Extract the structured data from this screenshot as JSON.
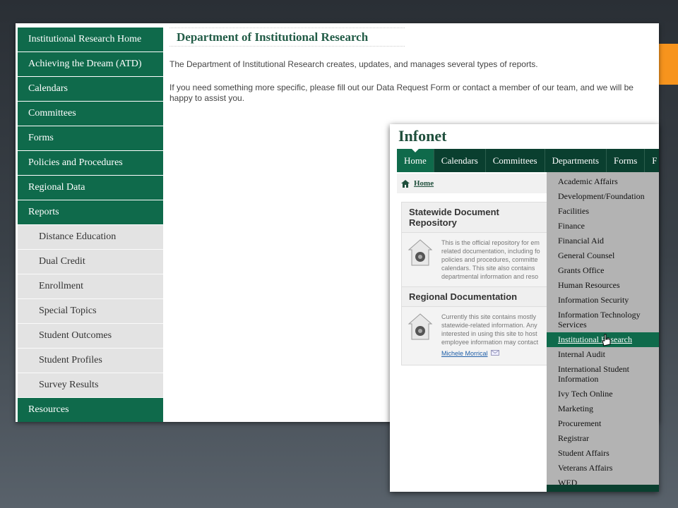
{
  "sidebar": {
    "items": [
      {
        "label": "Institutional Research Home",
        "style": "green"
      },
      {
        "label": "Achieving the Dream (ATD)",
        "style": "green"
      },
      {
        "label": "Calendars",
        "style": "green"
      },
      {
        "label": "Committees",
        "style": "green"
      },
      {
        "label": "Forms",
        "style": "green"
      },
      {
        "label": "Policies and Procedures",
        "style": "green"
      },
      {
        "label": "Regional Data",
        "style": "green"
      },
      {
        "label": "Reports",
        "style": "green"
      },
      {
        "label": "Distance Education",
        "style": "sub"
      },
      {
        "label": "Dual Credit",
        "style": "sub"
      },
      {
        "label": "Enrollment",
        "style": "sub"
      },
      {
        "label": "Special Topics",
        "style": "sub"
      },
      {
        "label": "Student Outcomes",
        "style": "sub"
      },
      {
        "label": "Student Profiles",
        "style": "sub"
      },
      {
        "label": "Survey Results",
        "style": "sub"
      },
      {
        "label": "Resources",
        "style": "green"
      }
    ]
  },
  "main": {
    "title": "Department of Institutional Research",
    "paragraph1": "The Department of Institutional Research creates, updates, and manages several types of reports.",
    "paragraph2": "If you need something more specific, please fill out our Data Request Form or contact a member of our team, and we will be happy to assist you."
  },
  "infonet": {
    "logo": "Infonet",
    "nav": [
      "Home",
      "Calendars",
      "Committees",
      "Departments",
      "Forms",
      "F"
    ],
    "breadcrumb": "Home",
    "panels": [
      {
        "title": "Statewide Document Repository",
        "text": "This is the official repository for em related documentation, including fo policies and procedures, committe calendars. This site also contains departmental information and reso"
      },
      {
        "title": "Regional Documentation",
        "text": "Currently this site contains mostly statewide-related information. Any interested in using this site to host employee information may contact",
        "link": "Michele Morrical"
      }
    ],
    "departments": [
      "Academic Affairs",
      "Development/Foundation",
      "Facilities",
      "Finance",
      "Financial Aid",
      "General Counsel",
      "Grants Office",
      "Human Resources",
      "Information Security",
      "Information Technology Services",
      "Institutional Research",
      "Internal Audit",
      "International Student Information",
      "Ivy Tech Online",
      "Marketing",
      "Procurement",
      "Registrar",
      "Student Affairs",
      "Veterans Affairs",
      "WED"
    ],
    "selected_department": "Institutional Research"
  },
  "colors": {
    "green": "#0f6a4b",
    "dark_green": "#0a3f2f",
    "orange": "#f7941d"
  }
}
